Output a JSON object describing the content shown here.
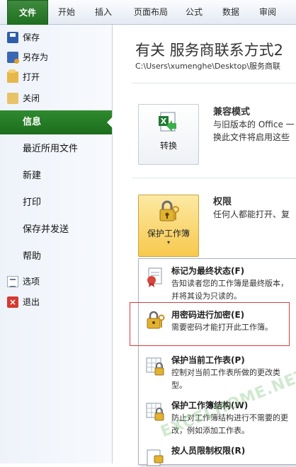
{
  "ribbon": {
    "tabs": [
      "文件",
      "开始",
      "插入",
      "页面布局",
      "公式",
      "数据",
      "审阅"
    ]
  },
  "sidebar": {
    "small_top": [
      {
        "label": "保存",
        "icon": "save-icon"
      },
      {
        "label": "另存为",
        "icon": "save-as-icon"
      },
      {
        "label": "打开",
        "icon": "open-folder-icon"
      },
      {
        "label": "关闭",
        "icon": "close-folder-icon"
      }
    ],
    "big": [
      "信息",
      "最近所用文件",
      "新建",
      "打印",
      "保存并发送",
      "帮助"
    ],
    "small_bottom": [
      {
        "label": "选项",
        "icon": "options-icon"
      },
      {
        "label": "退出",
        "icon": "exit-icon"
      }
    ],
    "active": "信息"
  },
  "main": {
    "title": "有关 服务商联系方式2",
    "path": "C:\\Users\\xumenghe\\Desktop\\服务商联",
    "compat": {
      "button_label": "转换",
      "title": "兼容模式",
      "desc_line1": "与旧版本的 Office 一",
      "desc_line2": "换此文件将启用这些"
    },
    "permissions": {
      "button_label": "保护工作簿",
      "title": "权限",
      "desc_line1": "任何人都能打开、复"
    }
  },
  "dropdown": {
    "items": [
      {
        "title": "标记为最终状态(F)",
        "desc": "告知读者您的工作簿是最终版本，并将其设为只读的。"
      },
      {
        "title": "用密码进行加密(E)",
        "desc": "需要密码才能打开此工作簿。"
      },
      {
        "title": "保护当前工作表(P)",
        "desc": "控制对当前工作表所做的更改类型。"
      },
      {
        "title": "保护工作簿结构(W)",
        "desc": "防止对工作簿结构进行不需要的更改，例如添加工作表。"
      },
      {
        "title": "按人员限制权限(R)",
        "desc": ""
      }
    ]
  },
  "watermark": "EXCELHOME.NET",
  "colors": {
    "accent": "#1f6e1f",
    "highlight": "#d83b3b"
  }
}
